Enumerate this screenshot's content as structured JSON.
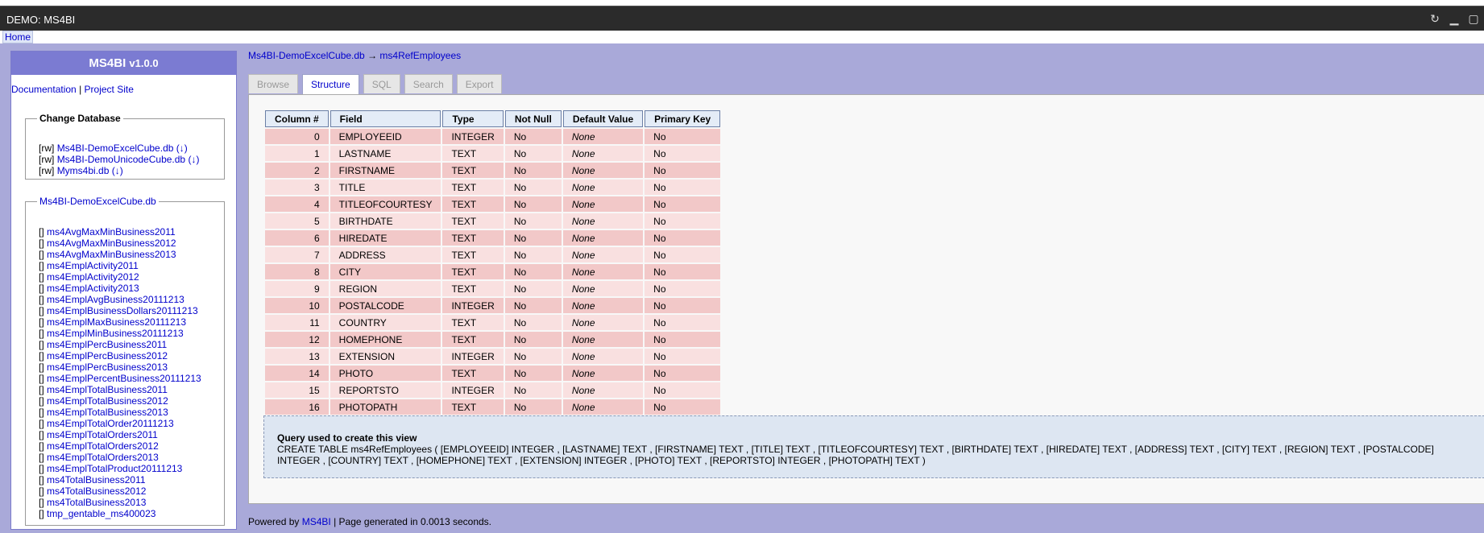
{
  "window": {
    "title": "DEMO: MS4BI"
  },
  "menubar": {
    "home": "Home"
  },
  "sidebar": {
    "app_name": "MS4BI",
    "version": "v1.0.0",
    "documentation": "Documentation",
    "separator": "|",
    "project_site": "Project Site",
    "change_db_legend": "Change Database",
    "databases": [
      {
        "mode": "[rw]",
        "name": "Ms4BI-DemoExcelCube.db",
        "arrow": "(↓)"
      },
      {
        "mode": "[rw]",
        "name": "Ms4BI-DemoUnicodeCube.db",
        "arrow": "(↓)"
      },
      {
        "mode": "[rw]",
        "name": "Myms4bi.db",
        "arrow": "(↓)"
      }
    ],
    "tables_legend": "Ms4BI-DemoExcelCube.db",
    "tables": [
      "ms4AvgMaxMinBusiness2011",
      "ms4AvgMaxMinBusiness2012",
      "ms4AvgMaxMinBusiness2013",
      "ms4EmplActivity2011",
      "ms4EmplActivity2012",
      "ms4EmplActivity2013",
      "ms4EmplAvgBusiness20111213",
      "ms4EmplBusinessDollars20111213",
      "ms4EmplMaxBusiness20111213",
      "ms4EmplMinBusiness20111213",
      "ms4EmplPercBusiness2011",
      "ms4EmplPercBusiness2012",
      "ms4EmplPercBusiness2013",
      "ms4EmplPercentBusiness20111213",
      "ms4EmplTotalBusiness2011",
      "ms4EmplTotalBusiness2012",
      "ms4EmplTotalBusiness2013",
      "ms4EmplTotalOrder20111213",
      "ms4EmplTotalOrders2011",
      "ms4EmplTotalOrders2012",
      "ms4EmplTotalOrders2013",
      "ms4EmplTotalProduct20111213",
      "ms4TotalBusiness2011",
      "ms4TotalBusiness2012",
      "ms4TotalBusiness2013",
      "tmp_gentable_ms400023"
    ],
    "table_prefix": "[]"
  },
  "breadcrumb": {
    "db": "Ms4BI-DemoExcelCube.db",
    "arrow": "→",
    "table": "ms4RefEmployees"
  },
  "tabs": [
    {
      "label": "Browse",
      "active": false
    },
    {
      "label": "Structure",
      "active": true
    },
    {
      "label": "SQL",
      "active": false
    },
    {
      "label": "Search",
      "active": false
    },
    {
      "label": "Export",
      "active": false
    }
  ],
  "structure": {
    "headers": [
      "Column #",
      "Field",
      "Type",
      "Not Null",
      "Default Value",
      "Primary Key"
    ],
    "rows": [
      [
        "0",
        "EMPLOYEEID",
        "INTEGER",
        "No",
        "None",
        "No"
      ],
      [
        "1",
        "LASTNAME",
        "TEXT",
        "No",
        "None",
        "No"
      ],
      [
        "2",
        "FIRSTNAME",
        "TEXT",
        "No",
        "None",
        "No"
      ],
      [
        "3",
        "TITLE",
        "TEXT",
        "No",
        "None",
        "No"
      ],
      [
        "4",
        "TITLEOFCOURTESY",
        "TEXT",
        "No",
        "None",
        "No"
      ],
      [
        "5",
        "BIRTHDATE",
        "TEXT",
        "No",
        "None",
        "No"
      ],
      [
        "6",
        "HIREDATE",
        "TEXT",
        "No",
        "None",
        "No"
      ],
      [
        "7",
        "ADDRESS",
        "TEXT",
        "No",
        "None",
        "No"
      ],
      [
        "8",
        "CITY",
        "TEXT",
        "No",
        "None",
        "No"
      ],
      [
        "9",
        "REGION",
        "TEXT",
        "No",
        "None",
        "No"
      ],
      [
        "10",
        "POSTALCODE",
        "INTEGER",
        "No",
        "None",
        "No"
      ],
      [
        "11",
        "COUNTRY",
        "TEXT",
        "No",
        "None",
        "No"
      ],
      [
        "12",
        "HOMEPHONE",
        "TEXT",
        "No",
        "None",
        "No"
      ],
      [
        "13",
        "EXTENSION",
        "INTEGER",
        "No",
        "None",
        "No"
      ],
      [
        "14",
        "PHOTO",
        "TEXT",
        "No",
        "None",
        "No"
      ],
      [
        "15",
        "REPORTSTO",
        "INTEGER",
        "No",
        "None",
        "No"
      ],
      [
        "16",
        "PHOTOPATH",
        "TEXT",
        "No",
        "None",
        "No"
      ]
    ]
  },
  "query": {
    "title": "Query used to create this view",
    "sql": "CREATE TABLE ms4RefEmployees ( [EMPLOYEEID] INTEGER , [LASTNAME] TEXT , [FIRSTNAME] TEXT , [TITLE] TEXT , [TITLEOFCOURTESY] TEXT , [BIRTHDATE] TEXT , [HIREDATE] TEXT , [ADDRESS] TEXT , [CITY] TEXT , [REGION] TEXT , [POSTALCODE] INTEGER , [COUNTRY] TEXT , [HOMEPHONE] TEXT , [EXTENSION] INTEGER , [PHOTO] TEXT , [REPORTSTO] INTEGER , [PHOTOPATH] TEXT )"
  },
  "footer": {
    "prefix": "Powered by",
    "link": "MS4BI",
    "suffix": "| Page generated in 0.0013 seconds."
  }
}
